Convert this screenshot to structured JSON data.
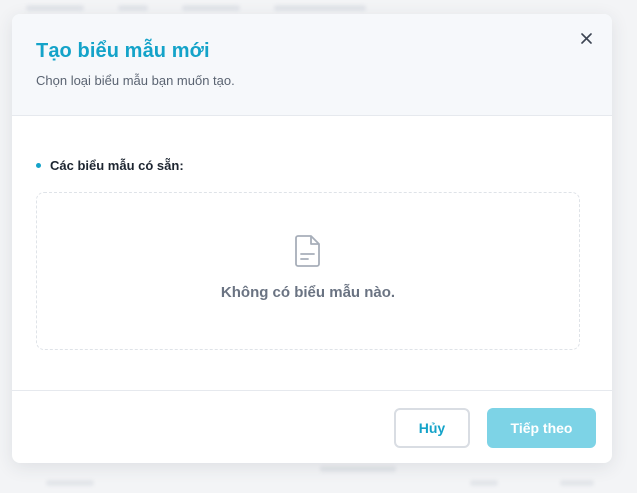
{
  "modal": {
    "title": "Tạo biểu mẫu mới",
    "subtitle": "Chọn loại biểu mẫu bạn muốn tạo.",
    "close_icon": "close-icon",
    "section_label": "Các biểu mẫu có sẵn:",
    "empty_state": {
      "icon": "document-icon",
      "text": "Không có biểu mẫu nào."
    },
    "footer": {
      "cancel_label": "Hủy",
      "next_label": "Tiếp theo",
      "next_disabled": true
    }
  },
  "colors": {
    "accent": "#14a3c9",
    "next_button_disabled": "#7dd3e6",
    "header_bg": "#f6f8fb"
  }
}
